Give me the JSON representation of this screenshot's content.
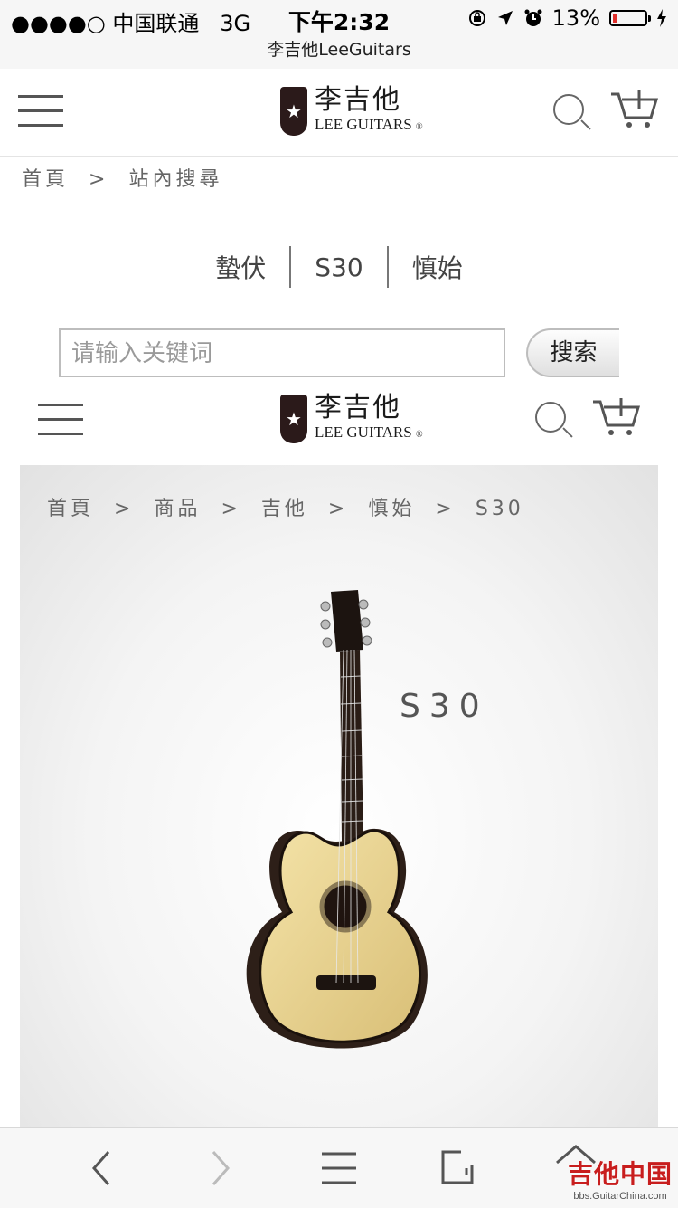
{
  "status_bar": {
    "carrier": "●●●●○ 中国联通",
    "network": "3G",
    "time": "下午2:32",
    "site_title": "李吉他LeeGuitars",
    "battery_percent": "13%",
    "battery_level": 0.13,
    "battery_color": "#e0302c"
  },
  "header": {
    "logo_cn": "李吉他",
    "logo_en": "LEE GUITARS",
    "logo_mark": "®"
  },
  "breadcrumb_top": {
    "items": [
      "首頁",
      "站內搜尋"
    ],
    "separator": ">"
  },
  "tabs": [
    "蟄伏",
    "S30",
    "慎始"
  ],
  "search": {
    "placeholder": "请输入关键词",
    "value": "",
    "button_label": "搜索"
  },
  "product": {
    "breadcrumb": [
      "首頁",
      "商品",
      "吉他",
      "慎始",
      "S30"
    ],
    "separator": ">",
    "model": "S30"
  },
  "toolbar": {
    "icons": [
      "back-icon",
      "forward-icon",
      "menu-icon",
      "share-icon",
      "home-icon"
    ]
  },
  "watermark": {
    "cn": "吉他中国",
    "en": "bbs.GuitarChina.com"
  }
}
